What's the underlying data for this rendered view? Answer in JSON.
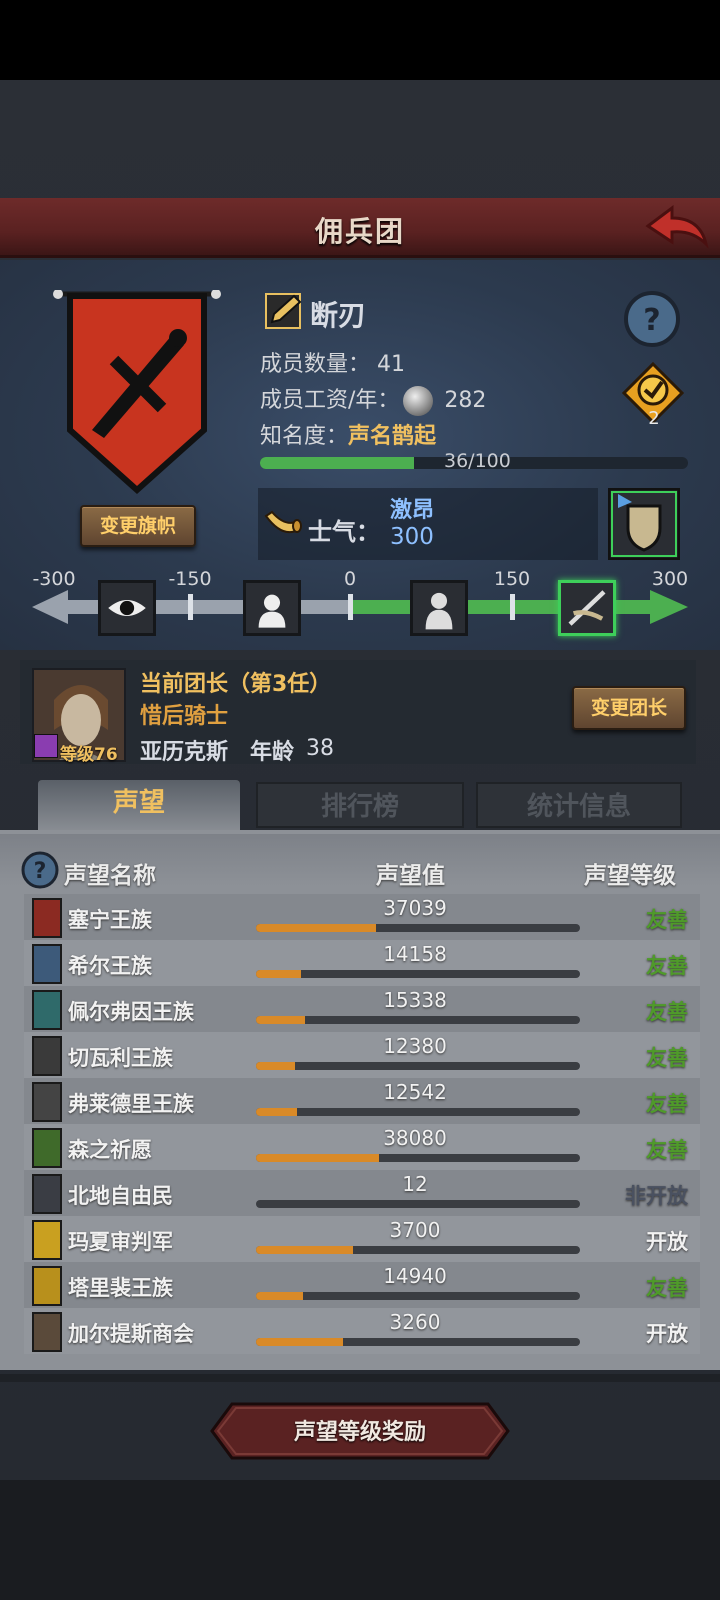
{
  "header": {
    "title": "佣兵团"
  },
  "guild": {
    "name": "断刃",
    "members_label": "成员数量：",
    "members": "41",
    "salary_label": "成员工资/年：",
    "salary": "282",
    "fame_label": "知名度：",
    "fame_title": "声名鹊起",
    "fame_progress": "36/100",
    "fame_fraction": 0.36,
    "badge_count": "2",
    "change_flag": "变更旗帜"
  },
  "morale": {
    "label": "士气：",
    "state": "激昂",
    "value": "300",
    "scale_labels": [
      "-300",
      "-150",
      "0",
      "150",
      "300"
    ]
  },
  "leader": {
    "title": "当前团长（第3任）",
    "role": "惜后骑士",
    "name": "亚历克斯",
    "age_label": "年龄",
    "age": "38",
    "level": "等级76",
    "change_button": "变更团长"
  },
  "tabs": [
    "声望",
    "排行榜",
    "统计信息"
  ],
  "list": {
    "columns": [
      "声望名称",
      "声望值",
      "声望等级"
    ],
    "rows": [
      {
        "name": "塞宁王族",
        "value": "37039",
        "fill": 0.37,
        "level": "友善",
        "level_color": "#4f9a2a",
        "icon_color": "#8b2a22"
      },
      {
        "name": "希尔王族",
        "value": "14158",
        "fill": 0.14,
        "level": "友善",
        "level_color": "#4f9a2a",
        "icon_color": "#3d5a7a"
      },
      {
        "name": "佩尔弗因王族",
        "value": "15338",
        "fill": 0.15,
        "level": "友善",
        "level_color": "#4f9a2a",
        "icon_color": "#2f6a6a"
      },
      {
        "name": "切瓦利王族",
        "value": "12380",
        "fill": 0.12,
        "level": "友善",
        "level_color": "#4f9a2a",
        "icon_color": "#3a3a3a"
      },
      {
        "name": "弗莱德里王族",
        "value": "12542",
        "fill": 0.125,
        "level": "友善",
        "level_color": "#4f9a2a",
        "icon_color": "#444"
      },
      {
        "name": "森之祈愿",
        "value": "38080",
        "fill": 0.38,
        "level": "友善",
        "level_color": "#4f9a2a",
        "icon_color": "#3f6a2a"
      },
      {
        "name": "北地自由民",
        "value": "12",
        "fill": 0.0,
        "level": "非开放",
        "level_color": "#4a5160",
        "icon_color": "#3a3d44"
      },
      {
        "name": "玛夏审判军",
        "value": "3700",
        "fill": 0.3,
        "level": "开放",
        "level_color": "#f2f2f2",
        "icon_color": "#c9a020"
      },
      {
        "name": "塔里裴王族",
        "value": "14940",
        "fill": 0.145,
        "level": "友善",
        "level_color": "#4f9a2a",
        "icon_color": "#b8901c"
      },
      {
        "name": "加尔提斯商会",
        "value": "3260",
        "fill": 0.27,
        "level": "开放",
        "level_color": "#f2f2f2",
        "icon_color": "#5a4a3a"
      }
    ]
  },
  "reward_button": "声望等级奖励",
  "colors": {
    "accent_gold": "#f0c060",
    "header_red": "#6e2b2a",
    "progress_orange": "#d98a28",
    "friendly_green": "#4f9a2a"
  }
}
